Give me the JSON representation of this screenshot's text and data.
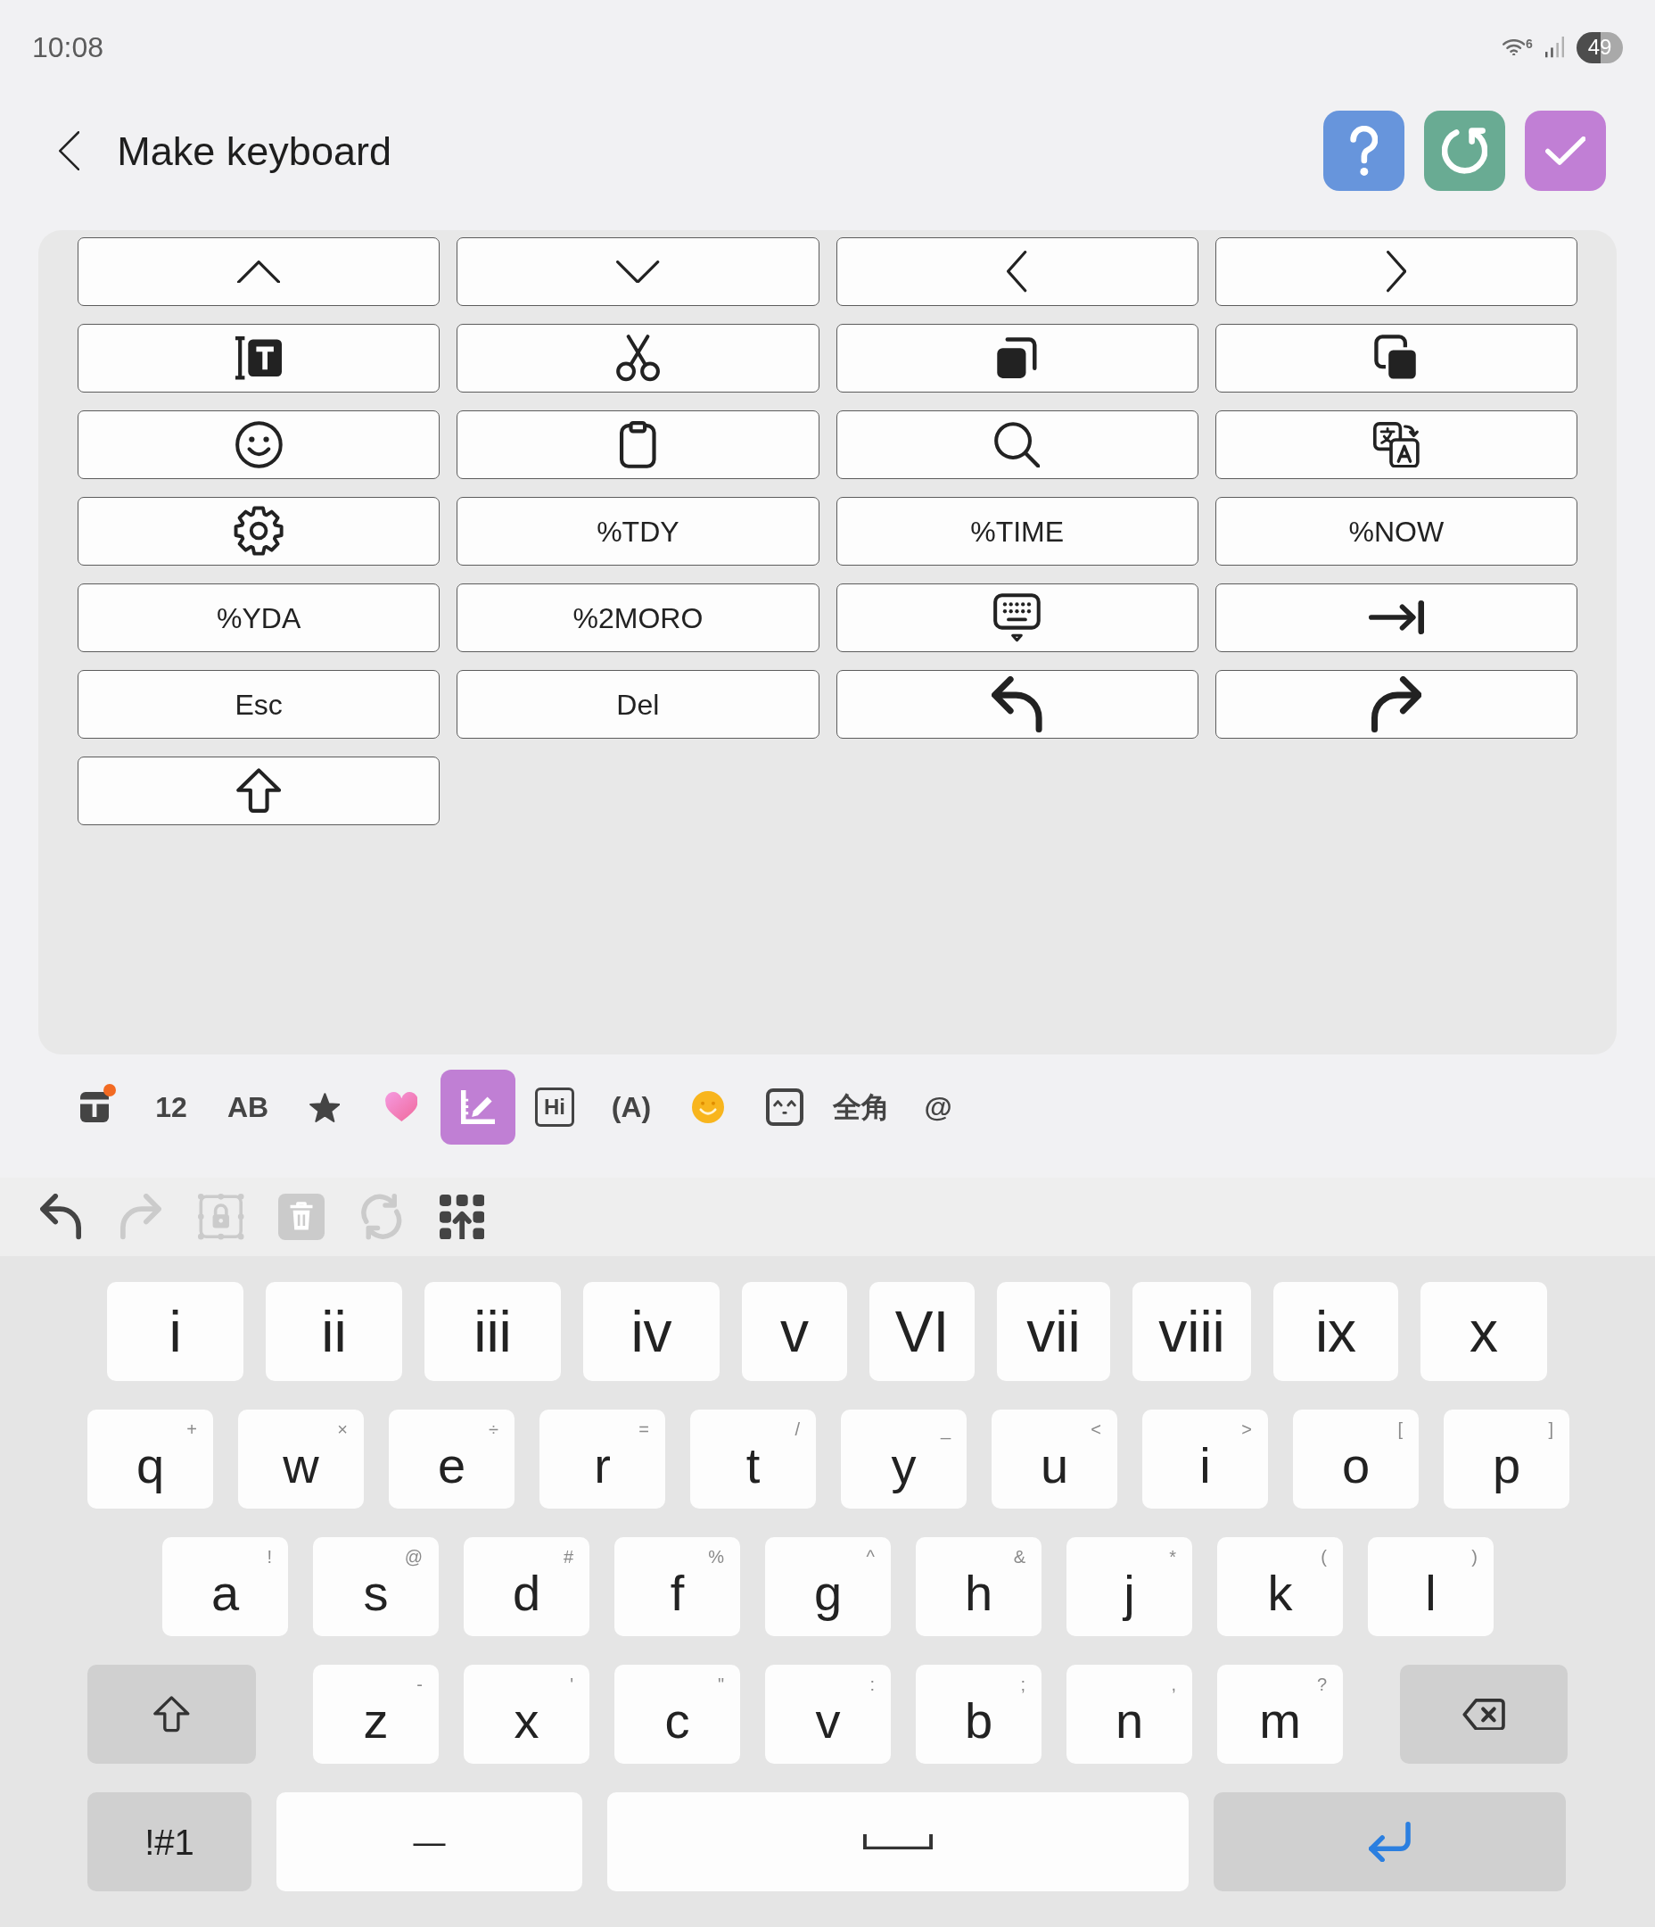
{
  "status_bar": {
    "time": "10:08",
    "wifi_label": "6",
    "battery": "49"
  },
  "header": {
    "title": "Make keyboard",
    "actions": [
      {
        "kind": "help",
        "color": "#6795dc"
      },
      {
        "kind": "reset",
        "color": "#69ab93"
      },
      {
        "kind": "done",
        "color": "#c17fd5"
      }
    ]
  },
  "key_panel": {
    "keys": [
      {
        "kind": "up"
      },
      {
        "kind": "down"
      },
      {
        "kind": "left"
      },
      {
        "kind": "right"
      },
      {
        "kind": "selectall"
      },
      {
        "kind": "cut"
      },
      {
        "kind": "copy"
      },
      {
        "kind": "paste"
      },
      {
        "kind": "emoji"
      },
      {
        "kind": "clipboard"
      },
      {
        "kind": "search"
      },
      {
        "kind": "translate"
      },
      {
        "kind": "settings"
      },
      {
        "kind": "text",
        "label": "%TDY"
      },
      {
        "kind": "text",
        "label": "%TIME"
      },
      {
        "kind": "text",
        "label": "%NOW"
      },
      {
        "kind": "text",
        "label": "%YDA"
      },
      {
        "kind": "text",
        "label": "%2MORO"
      },
      {
        "kind": "hide"
      },
      {
        "kind": "tab"
      },
      {
        "kind": "text",
        "label": "Esc"
      },
      {
        "kind": "text",
        "label": "Del"
      },
      {
        "kind": "undo"
      },
      {
        "kind": "redo"
      },
      {
        "kind": "shift"
      }
    ]
  },
  "toolbar": {
    "items": [
      {
        "kind": "gift",
        "badge": true,
        "selected": false
      },
      {
        "kind": "text",
        "label": "12",
        "badge": false,
        "selected": false
      },
      {
        "kind": "text",
        "label": "AB",
        "badge": false,
        "selected": false
      },
      {
        "kind": "star",
        "badge": false,
        "selected": false
      },
      {
        "kind": "heart",
        "badge": false,
        "selected": false
      },
      {
        "kind": "editor",
        "badge": false,
        "selected": true
      },
      {
        "kind": "boxed",
        "label": "Hi",
        "badge": false,
        "selected": false
      },
      {
        "kind": "text",
        "label": "(A)",
        "badge": false,
        "selected": false
      },
      {
        "kind": "emoji",
        "badge": false,
        "selected": false
      },
      {
        "kind": "emoticon",
        "badge": false,
        "selected": false
      },
      {
        "kind": "text",
        "label": "全角",
        "badge": false,
        "selected": false
      },
      {
        "kind": "text",
        "label": "@",
        "badge": false,
        "selected": false
      }
    ]
  },
  "edit_toolbar": {
    "items": [
      {
        "kind": "undo",
        "disabled": false
      },
      {
        "kind": "redo",
        "disabled": true
      },
      {
        "kind": "lock",
        "disabled": true
      },
      {
        "kind": "delete",
        "disabled": true
      },
      {
        "kind": "refresh",
        "disabled": true
      },
      {
        "kind": "layout",
        "disabled": false
      }
    ]
  },
  "keyboard": {
    "rows": [
      [
        {
          "kind": "char",
          "label": "i"
        },
        {
          "kind": "char",
          "label": "ii"
        },
        {
          "kind": "char",
          "label": "iii"
        },
        {
          "kind": "char",
          "label": "iv"
        },
        {
          "kind": "char",
          "label": "v"
        },
        {
          "kind": "char",
          "label": "VI"
        },
        {
          "kind": "char",
          "label": "vii"
        },
        {
          "kind": "char",
          "label": "viii"
        },
        {
          "kind": "char",
          "label": "ix"
        },
        {
          "kind": "char",
          "label": "x"
        }
      ],
      [
        {
          "kind": "char",
          "label": "q",
          "hint": "+"
        },
        {
          "kind": "char",
          "label": "w",
          "hint": "×"
        },
        {
          "kind": "char",
          "label": "e",
          "hint": "÷"
        },
        {
          "kind": "char",
          "label": "r",
          "hint": "="
        },
        {
          "kind": "char",
          "label": "t",
          "hint": "/"
        },
        {
          "kind": "char",
          "label": "y",
          "hint": "_"
        },
        {
          "kind": "char",
          "label": "u",
          "hint": "<"
        },
        {
          "kind": "char",
          "label": "i",
          "hint": ">"
        },
        {
          "kind": "char",
          "label": "o",
          "hint": "["
        },
        {
          "kind": "char",
          "label": "p",
          "hint": "]"
        }
      ],
      [
        {
          "kind": "char",
          "label": "a",
          "hint": "!"
        },
        {
          "kind": "char",
          "label": "s",
          "hint": "@"
        },
        {
          "kind": "char",
          "label": "d",
          "hint": "#"
        },
        {
          "kind": "char",
          "label": "f",
          "hint": "%"
        },
        {
          "kind": "char",
          "label": "g",
          "hint": "^"
        },
        {
          "kind": "char",
          "label": "h",
          "hint": "&"
        },
        {
          "kind": "char",
          "label": "j",
          "hint": "*"
        },
        {
          "kind": "char",
          "label": "k",
          "hint": "("
        },
        {
          "kind": "char",
          "label": "l",
          "hint": ")"
        }
      ],
      [
        {
          "kind": "shift"
        },
        {
          "kind": "char",
          "label": "z",
          "hint": "-"
        },
        {
          "kind": "char",
          "label": "x",
          "hint": "'"
        },
        {
          "kind": "char",
          "label": "c",
          "hint": "\""
        },
        {
          "kind": "char",
          "label": "v",
          "hint": ":"
        },
        {
          "kind": "char",
          "label": "b",
          "hint": ";"
        },
        {
          "kind": "char",
          "label": "n",
          "hint": ","
        },
        {
          "kind": "char",
          "label": "m",
          "hint": "?"
        },
        {
          "kind": "backspace"
        }
      ],
      [
        {
          "kind": "mode",
          "label": "!#1"
        },
        {
          "kind": "char",
          "label": "—"
        },
        {
          "kind": "space"
        },
        {
          "kind": "enter"
        }
      ]
    ]
  }
}
